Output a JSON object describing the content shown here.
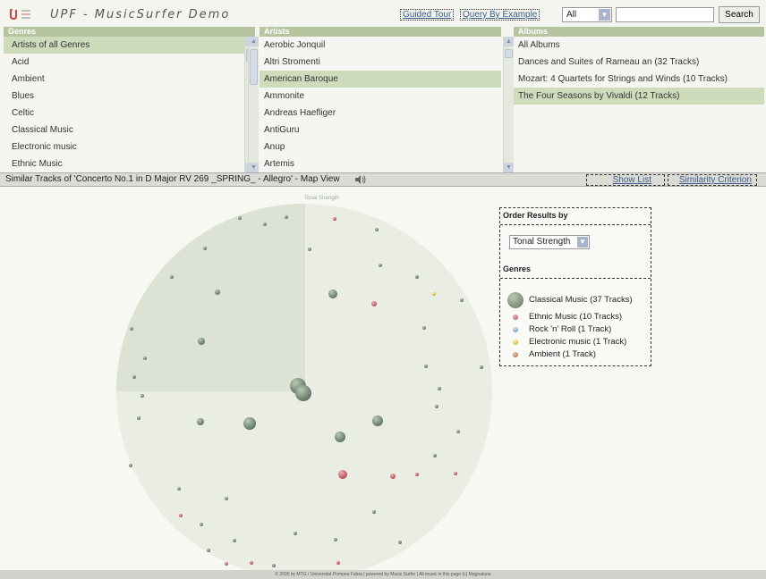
{
  "app": {
    "title": "UPF - MusicSurfer Demo"
  },
  "toolbar": {
    "guided_tour": "Guided Tour",
    "query_by_example": "Query By Example",
    "scope_value": "All",
    "search_value": "",
    "search_button": "Search"
  },
  "genres": {
    "header": "Genres",
    "items": [
      "Artists of all Genres",
      "Acid",
      "Ambient",
      "Blues",
      "Celtic",
      "Classical Music",
      "Electronic music",
      "Ethnic Music"
    ],
    "selected_index": 0
  },
  "artists": {
    "header": "Artists",
    "items": [
      "Aerobic Jonquil",
      "Altri Stromenti",
      "American Baroque",
      "Ammonite",
      "Andreas Haefliger",
      "AntiGuru",
      "Anup",
      "Artemis"
    ],
    "selected_index": 2
  },
  "albums": {
    "header": "Albums",
    "items": [
      "All Albums",
      "Dances and Suites of Rameau an (32 Tracks)",
      "Mozart: 4 Quartets for Strings and Winds (10 Tracks)",
      "The Four Seasons by Vivaldi (12 Tracks)"
    ],
    "selected_index": 3
  },
  "similar_bar": {
    "text": "Similar Tracks of 'Concerto No.1 in D Major RV 269 _SPRING_ - Allegro' - Map View",
    "show_list": "Show List",
    "similarity_criterion": "Similarity Criterion"
  },
  "map": {
    "criterion_label": "Tonal Strength"
  },
  "options": {
    "order_title": "Order Results by",
    "order_value": "Tonal Strength",
    "genres_title": "Genres",
    "legend": [
      {
        "label": "Classical Music (37 Tracks)",
        "color": "#7e937d"
      },
      {
        "label": "Ethnic Music (10 Tracks)",
        "color": "#c96a72"
      },
      {
        "label": "Rock 'n' Roll (1 Track)",
        "color": "#7fa9c6"
      },
      {
        "label": "Electronic music (1 Track)",
        "color": "#d9c04a"
      },
      {
        "label": "Ambient (1 Track)",
        "color": "#c08055"
      }
    ]
  },
  "footer": {
    "text": "© 2005 by MTG / Universitat Pompeu Fabra | powered by Music Surfer | All music in this page (c) Magnatune"
  },
  "colors": {
    "header_green": "#b7c4a0",
    "selected_green": "#cfdcbc",
    "link_blue": "#3a5d8a"
  }
}
